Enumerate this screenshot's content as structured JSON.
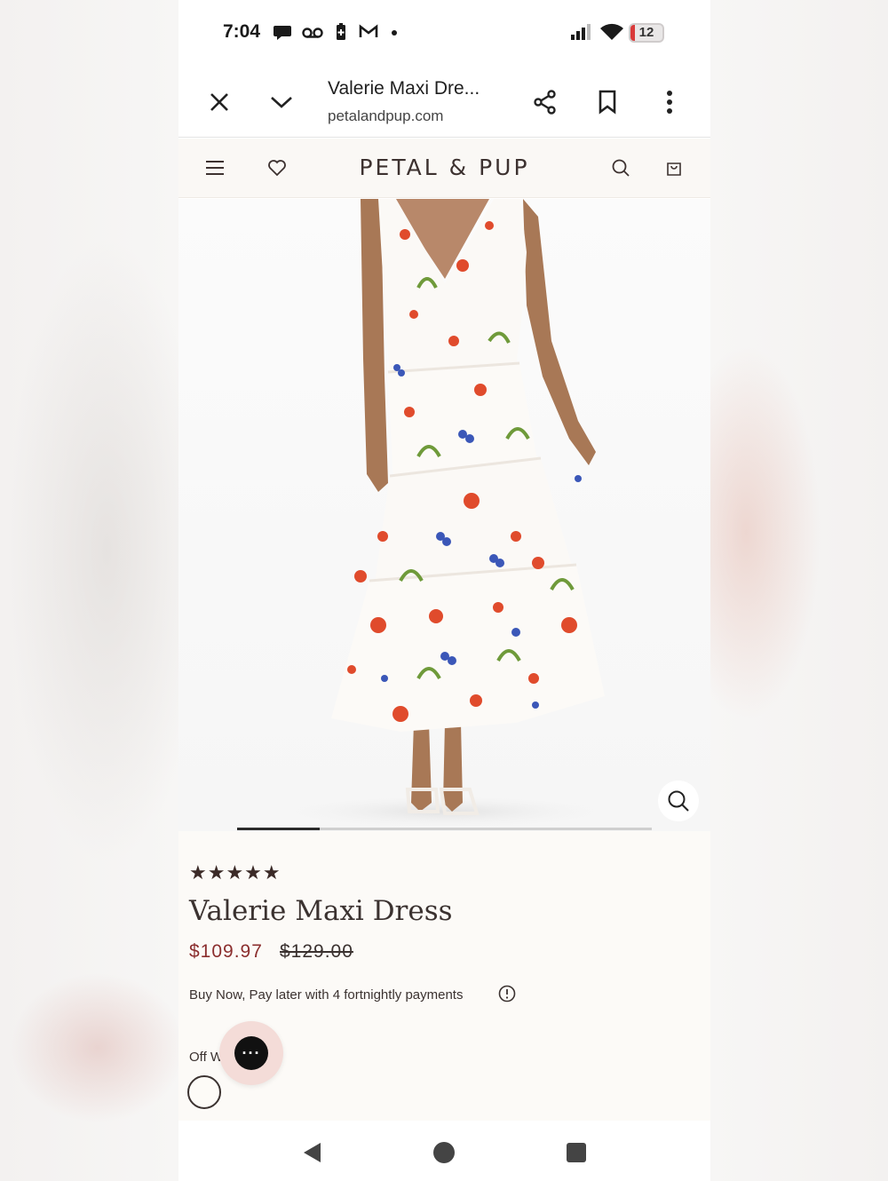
{
  "status_bar": {
    "time": "7:04",
    "battery_level": "12",
    "icons": [
      "chat-icon",
      "voicemail-icon",
      "battery-saver-icon",
      "gmail-icon",
      "dot-icon",
      "signal-icon",
      "wifi-icon"
    ]
  },
  "browser": {
    "title": "Valerie Maxi Dre...",
    "url": "petalandpup.com",
    "icons": [
      "close-icon",
      "chevron-down-icon",
      "share-icon",
      "bookmark-icon",
      "more-vert-icon"
    ]
  },
  "site_header": {
    "logo": "PETAL & PUP",
    "icons": [
      "menu-icon",
      "heart-icon",
      "search-icon",
      "bag-icon"
    ]
  },
  "gallery": {
    "image_alt_icon": "zoom-icon",
    "progress": 0.2
  },
  "product": {
    "stars": "★★★★★",
    "rating": 5,
    "title": "Valerie Maxi Dress",
    "sale_price": "$109.97",
    "original_price": "$129.00",
    "paylater_text": "Buy Now, Pay later with 4 fortnightly payments",
    "color_label": "Off W",
    "chat_icon": "chat-bubble-icon"
  },
  "colors": {
    "accent_price": "#8b2e2e",
    "text": "#3b3230",
    "header_bg": "#faf8f5",
    "chat_bg": "#f4dcd8"
  },
  "nav": {
    "icons": [
      "back-icon",
      "home-icon",
      "recents-icon"
    ]
  }
}
